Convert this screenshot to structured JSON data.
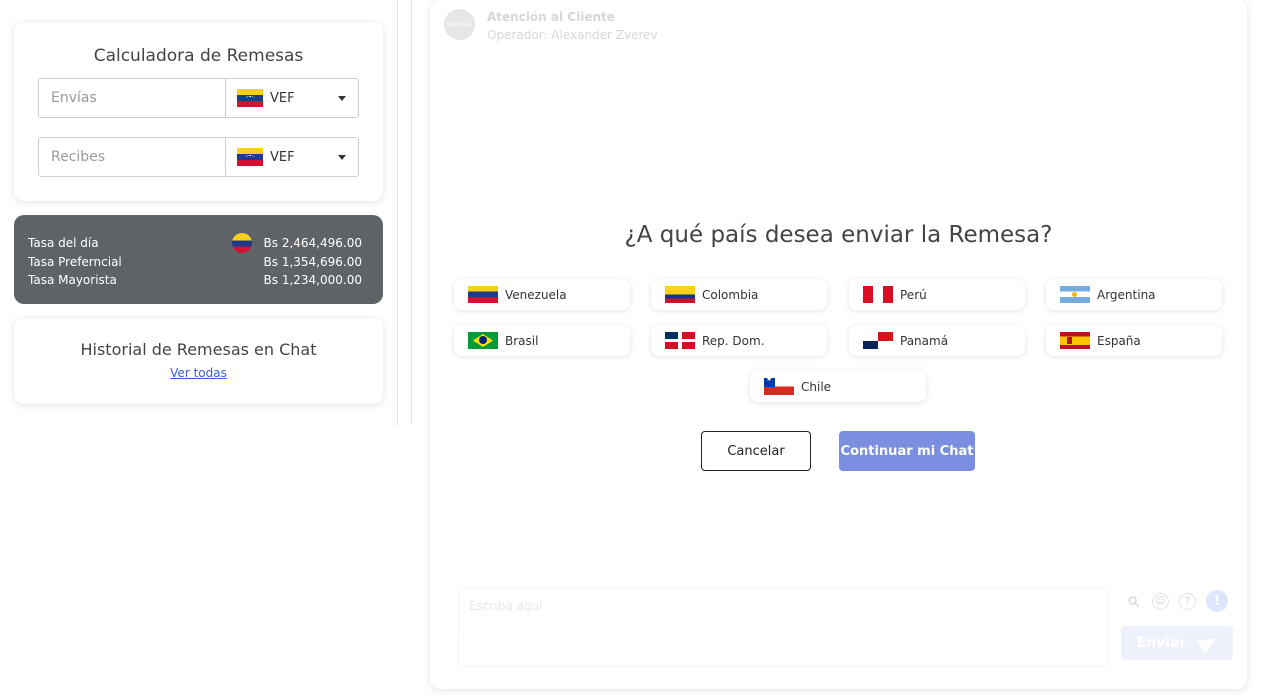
{
  "calculator": {
    "title": "Calculadora de Remesas",
    "send_placeholder": "Envías",
    "send_currency": "VEF",
    "receive_placeholder": "Recibes",
    "receive_currency": "VEF"
  },
  "rates": [
    {
      "label": "Tasa del día",
      "value": "Bs 2,464,496.00"
    },
    {
      "label": "Tasa Preferncial",
      "value": "Bs 1,354,696.00"
    },
    {
      "label": "Tasa Mayorista",
      "value": "Bs 1,234,000.00"
    }
  ],
  "history": {
    "title": "Historial de Remesas en Chat",
    "link": "Ver todas"
  },
  "chat": {
    "header_title": "Atención al Cliente",
    "header_subtitle": "Operador: Alexander Zverev",
    "avatar_text": "remesas",
    "question": "¿A qué país desea enviar la Remesa?",
    "countries": [
      {
        "name": "Venezuela",
        "flag": "ve"
      },
      {
        "name": "Colombia",
        "flag": "co"
      },
      {
        "name": "Perú",
        "flag": "pe"
      },
      {
        "name": "Argentina",
        "flag": "ar"
      },
      {
        "name": "Brasil",
        "flag": "br"
      },
      {
        "name": "Rep. Dom.",
        "flag": "do"
      },
      {
        "name": "Panamá",
        "flag": "pa"
      },
      {
        "name": "España",
        "flag": "es"
      },
      {
        "name": "Chile",
        "flag": "cl"
      }
    ],
    "cancel_label": "Cancelar",
    "continue_label": "Continuar mi Chat",
    "input_placeholder": "Escriba aquí",
    "send_label": "Enviar",
    "info_icon_text": "!"
  }
}
